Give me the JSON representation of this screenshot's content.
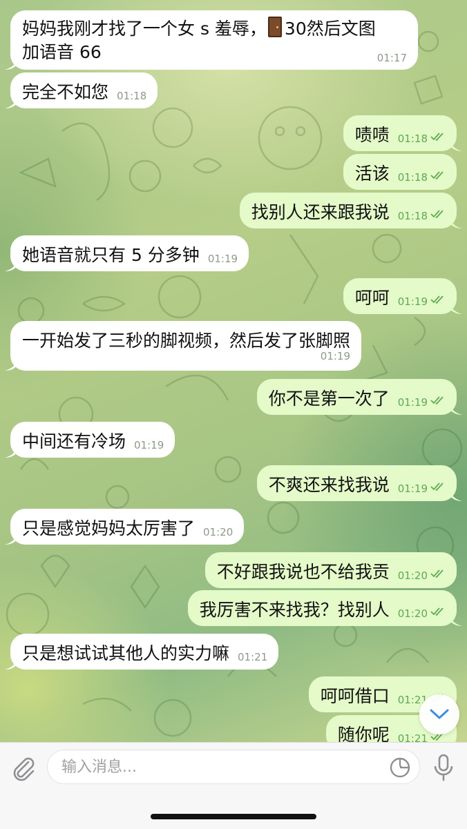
{
  "composer": {
    "placeholder": "输入消息..."
  },
  "messages": [
    {
      "side": "in",
      "line1": "妈妈我刚才找了一个女 s 羞辱，",
      "emoji": "door-emoji",
      "line1_after": "30然后文图",
      "line2": "加语音 66",
      "time": "01:17"
    },
    {
      "side": "in",
      "text": "完全不如您",
      "time": "01:18"
    },
    {
      "side": "out",
      "text": "啧啧",
      "time": "01:18"
    },
    {
      "side": "out",
      "text": "活该",
      "time": "01:18"
    },
    {
      "side": "out",
      "text": "找别人还来跟我说",
      "time": "01:18"
    },
    {
      "side": "in",
      "text": "她语音就只有 5 分多钟",
      "time": "01:19"
    },
    {
      "side": "out",
      "text": "呵呵",
      "time": "01:19"
    },
    {
      "side": "in",
      "text": "一开始发了三秒的脚视频，然后发了张脚照",
      "time": "01:19"
    },
    {
      "side": "out",
      "text": "你不是第一次了",
      "time": "01:19"
    },
    {
      "side": "in",
      "text": "中间还有冷场",
      "time": "01:19"
    },
    {
      "side": "out",
      "text": "不爽还来找我说",
      "time": "01:19"
    },
    {
      "side": "in",
      "text": "只是感觉妈妈太厉害了",
      "time": "01:20"
    },
    {
      "side": "out",
      "text": "不好跟我说也不给我贡",
      "time": "01:20"
    },
    {
      "side": "out",
      "text": "我厉害不来找我？找别人",
      "time": "01:20"
    },
    {
      "side": "in",
      "text": "只是想试试其他人的实力嘛",
      "time": "01:21"
    },
    {
      "side": "out",
      "text": "呵呵借口",
      "time": "01:21"
    },
    {
      "side": "out",
      "text": "随你呢",
      "time": "01:21"
    }
  ],
  "colors": {
    "incoming_bubble": "#ffffff",
    "outgoing_bubble": "#e4fac9",
    "outgoing_meta": "#5ea951",
    "scroll_button_icon": "#3a8ee6"
  },
  "icons": {
    "attach": "paperclip-icon",
    "sticker": "sticker-icon",
    "mic": "microphone-icon",
    "scroll": "chevron-down-icon",
    "read": "double-check-icon"
  }
}
